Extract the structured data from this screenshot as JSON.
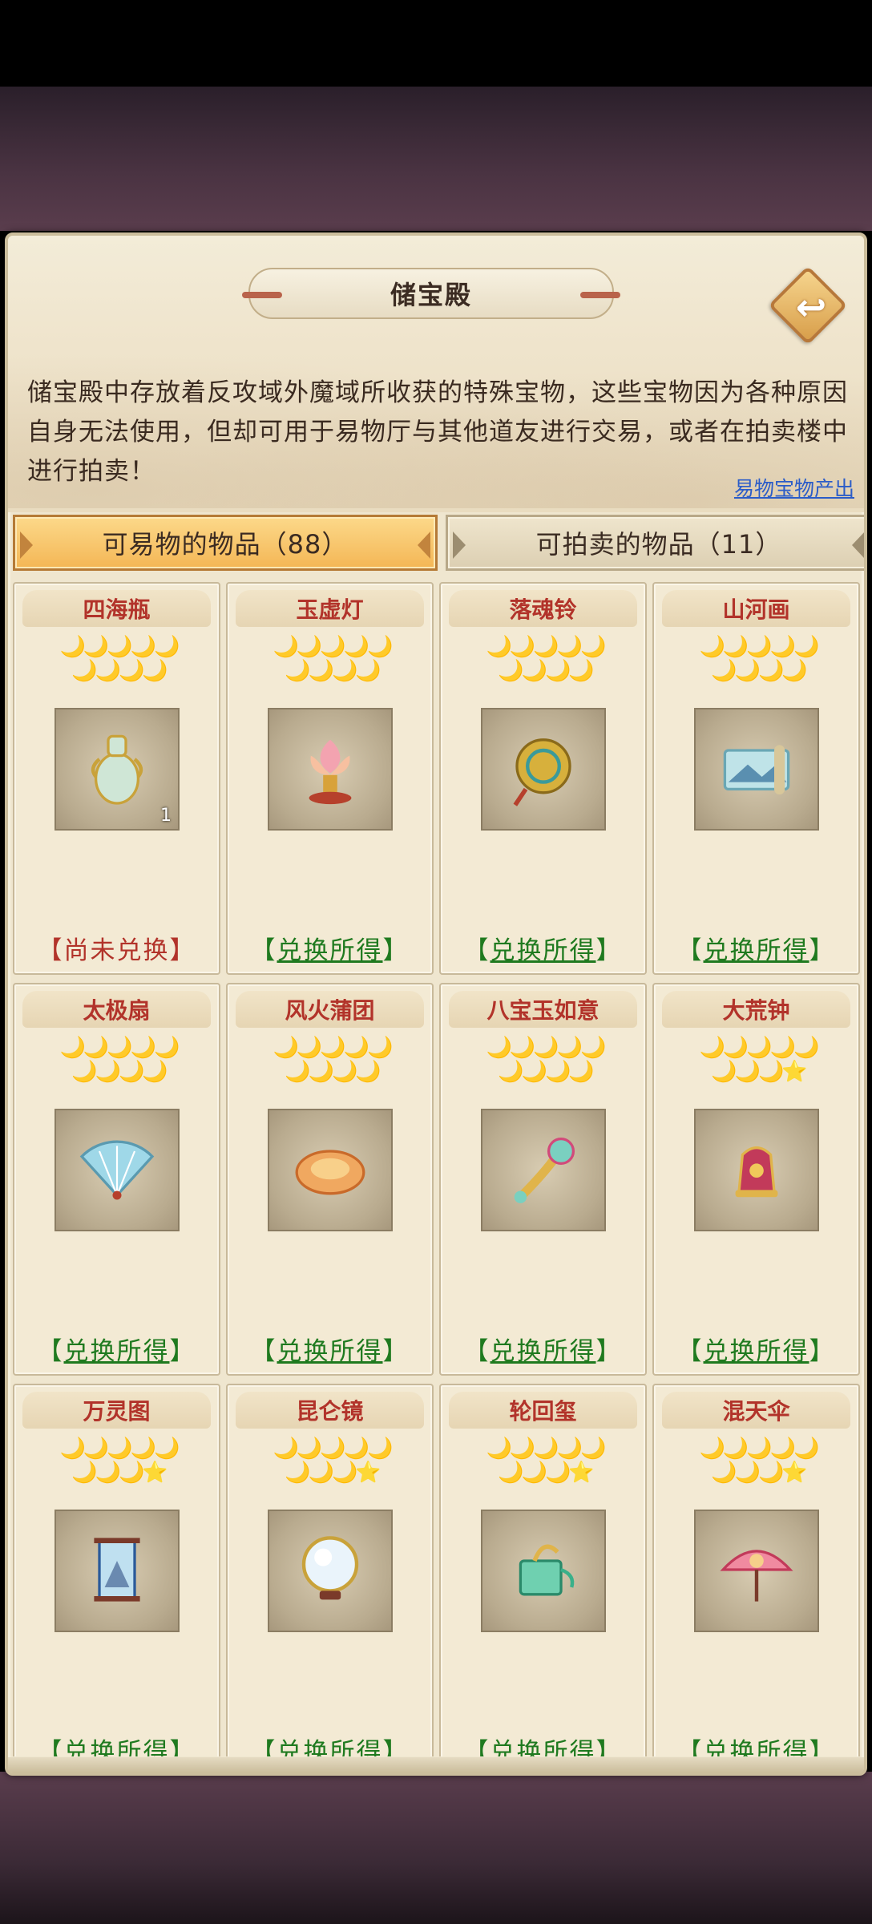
{
  "title": "储宝殿",
  "back_icon": "back-arrow-icon",
  "description": "储宝殿中存放着反攻域外魔域所收获的特殊宝物，这些宝物因为各种原因自身无法使用，但却可用于易物厅与其他道友进行交易，或者在拍卖楼中进行拍卖！",
  "source_link": "易物宝物产出",
  "tabs": [
    {
      "label": "可易物的物品（88）",
      "active": true
    },
    {
      "label": "可拍卖的物品（11）",
      "active": false
    }
  ],
  "colors": {
    "name_red": "#b2332a",
    "status_green": "#1f7a1f",
    "tab_active": "#f4b655",
    "link_blue": "#2b5cc8"
  },
  "items": [
    {
      "name": "四海瓶",
      "stars": "🌙🌙🌙🌙🌙\n🌙🌙🌙🌙",
      "icon": "vase-icon",
      "quantity": "1",
      "status": "尚未兑换",
      "status_type": "pending"
    },
    {
      "name": "玉虚灯",
      "stars": "🌙🌙🌙🌙🌙\n🌙🌙🌙🌙",
      "icon": "lotus-lamp-icon",
      "quantity": "",
      "status": "兑换所得",
      "status_type": "obtained"
    },
    {
      "name": "落魂铃",
      "stars": "🌙🌙🌙🌙🌙\n🌙🌙🌙🌙",
      "icon": "bell-icon",
      "quantity": "",
      "status": "兑换所得",
      "status_type": "obtained"
    },
    {
      "name": "山河画",
      "stars": "🌙🌙🌙🌙🌙\n🌙🌙🌙🌙",
      "icon": "scroll-painting-icon",
      "quantity": "",
      "status": "兑换所得",
      "status_type": "obtained"
    },
    {
      "name": "太极扇",
      "stars": "🌙🌙🌙🌙🌙\n🌙🌙🌙🌙",
      "icon": "fan-icon",
      "quantity": "",
      "status": "兑换所得",
      "status_type": "obtained"
    },
    {
      "name": "风火蒲团",
      "stars": "🌙🌙🌙🌙🌙\n🌙🌙🌙🌙",
      "icon": "cushion-icon",
      "quantity": "",
      "status": "兑换所得",
      "status_type": "obtained"
    },
    {
      "name": "八宝玉如意",
      "stars": "🌙🌙🌙🌙🌙\n🌙🌙🌙🌙",
      "icon": "ruyi-scepter-icon",
      "quantity": "",
      "status": "兑换所得",
      "status_type": "obtained"
    },
    {
      "name": "大荒钟",
      "stars": "🌙🌙🌙🌙🌙\n🌙🌙🌙⭐",
      "icon": "great-bell-icon",
      "quantity": "",
      "status": "兑换所得",
      "status_type": "obtained"
    },
    {
      "name": "万灵图",
      "stars": "🌙🌙🌙🌙🌙\n🌙🌙🌙⭐",
      "icon": "hanging-scroll-icon",
      "quantity": "",
      "status": "兑换所得",
      "status_type": "obtained"
    },
    {
      "name": "昆仑镜",
      "stars": "🌙🌙🌙🌙🌙\n🌙🌙🌙⭐",
      "icon": "mirror-icon",
      "quantity": "",
      "status": "兑换所得",
      "status_type": "obtained"
    },
    {
      "name": "轮回玺",
      "stars": "🌙🌙🌙🌙🌙\n🌙🌙🌙⭐",
      "icon": "jade-seal-icon",
      "quantity": "",
      "status": "兑换所得",
      "status_type": "obtained"
    },
    {
      "name": "混天伞",
      "stars": "🌙🌙🌙🌙🌙\n🌙🌙🌙⭐",
      "icon": "umbrella-icon",
      "quantity": "",
      "status": "兑换所得",
      "status_type": "obtained"
    }
  ]
}
